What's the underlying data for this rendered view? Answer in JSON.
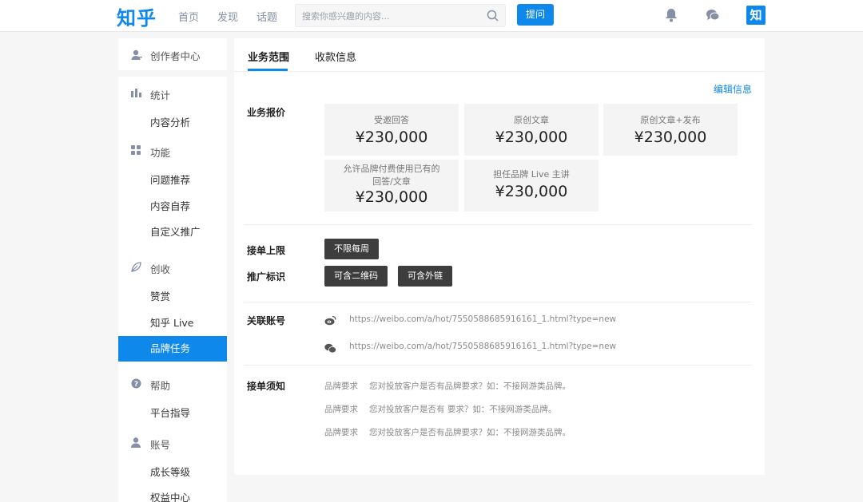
{
  "header": {
    "logo": "知乎",
    "nav": [
      "首页",
      "发现",
      "话题"
    ],
    "search_placeholder": "搜索你感兴趣的内容...",
    "ask_label": "提问",
    "avatar_text": "知"
  },
  "sidebar": {
    "creator_center": "创作者中心",
    "sections": [
      {
        "title": "统计",
        "items": [
          "内容分析"
        ]
      },
      {
        "title": "功能",
        "items": [
          "问题推荐",
          "内容自荐",
          "自定义推广"
        ]
      },
      {
        "title": "创收",
        "items": [
          "赞赏",
          "知乎 Live",
          "品牌任务"
        ]
      },
      {
        "title": "帮助",
        "items": [
          "平台指导"
        ]
      },
      {
        "title": "账号",
        "items": [
          "成长等级",
          "权益中心"
        ]
      }
    ],
    "active_item": "品牌任务"
  },
  "tabs": [
    "业务范围",
    "收款信息"
  ],
  "edit_label": "编辑信息",
  "pricing": {
    "label": "业务报价",
    "items": [
      {
        "name": "受邀回答",
        "price": "¥230,000"
      },
      {
        "name": "原创文章",
        "price": "¥230,000"
      },
      {
        "name": "原创文章+发布",
        "price": "¥230,000"
      },
      {
        "name": "允许品牌付费使用已有的回答/文章",
        "name_lines": [
          "允许品牌付费使用已有的",
          "回答/文章"
        ],
        "price": "¥230,000"
      },
      {
        "name": "担任品牌 Live 主讲",
        "price": "¥230,000"
      }
    ]
  },
  "order_limit": {
    "label": "接单上限",
    "value": "不限每周"
  },
  "promo_tags": {
    "label": "推广标识",
    "values": [
      "可含二维码",
      "可含外链"
    ]
  },
  "linked_accounts": {
    "label": "关联账号",
    "items": [
      {
        "icon": "weibo-icon",
        "url": "https://weibo.com/a/hot/7550588685916161_1.html?type=new"
      },
      {
        "icon": "wechat-icon",
        "url": "https://weibo.com/a/hot/7550588685916161_1.html?type=new"
      }
    ]
  },
  "notes": {
    "label": "接单须知",
    "items": [
      {
        "key": "品牌要求",
        "text": "您对投放客户是否有品牌要求？如：不接网游类品牌。"
      },
      {
        "key": "品牌要求",
        "text": "您对投放客户是否有 要求？如：不接网游类品牌。"
      },
      {
        "key": "品牌要求",
        "text": "您对投放客户是否有品牌要求？如：不接网游类品牌。"
      }
    ]
  },
  "colors": {
    "accent": "#0f88eb",
    "dark_button": "#3d3d3d",
    "card_bg": "#f4f4f4"
  }
}
